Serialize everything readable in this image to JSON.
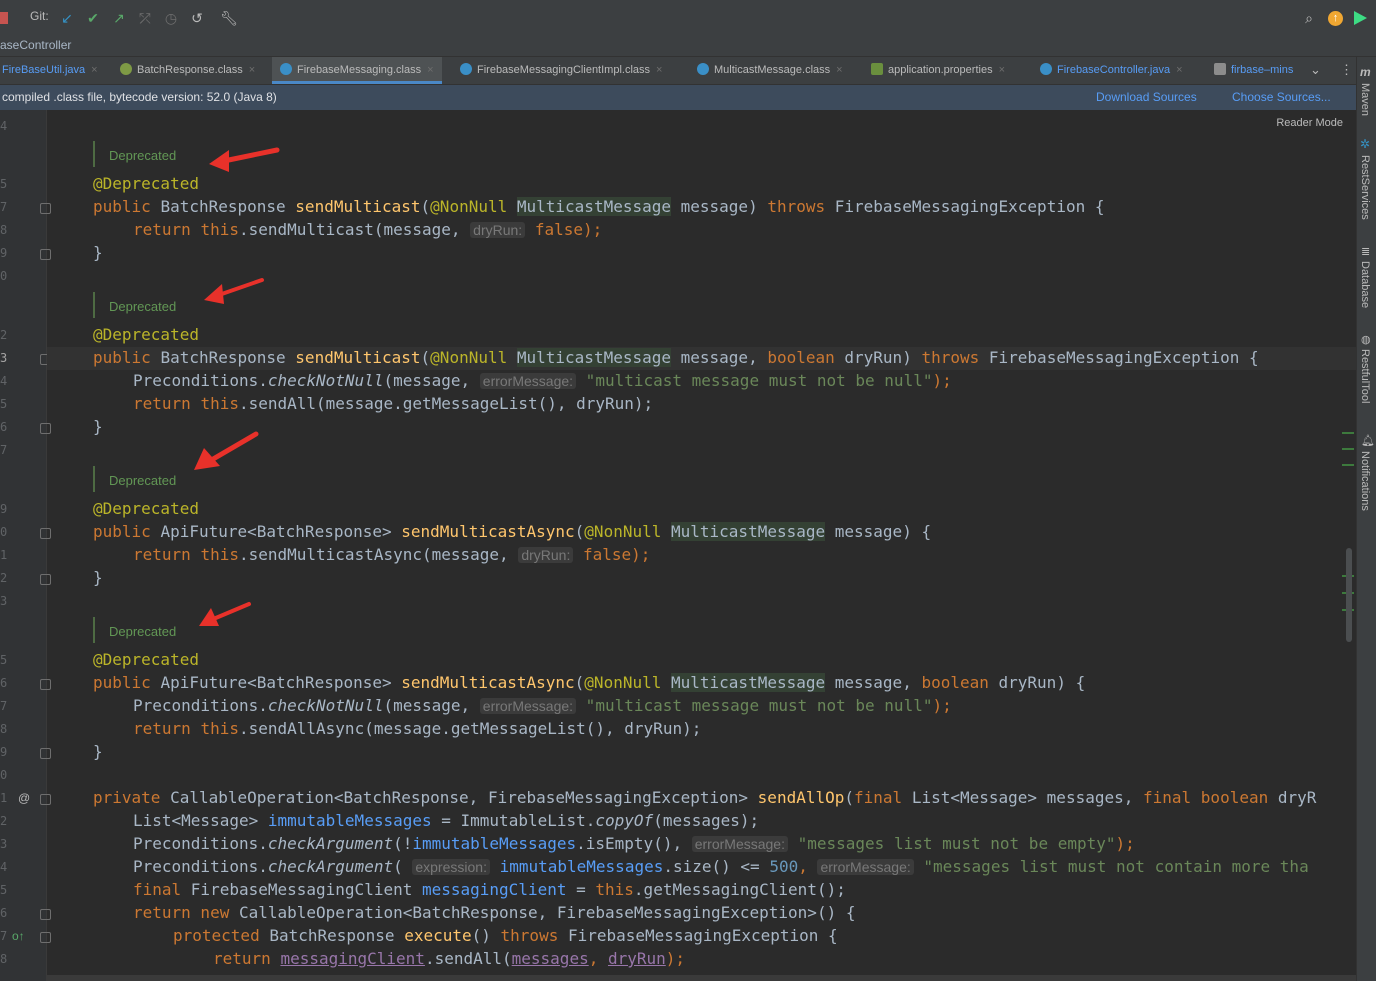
{
  "toolbar": {
    "git_label": "Git:",
    "icons": [
      "stop-icon",
      "git-update-icon",
      "git-commit-icon",
      "git-push-icon",
      "git-merge-icon",
      "history-icon",
      "rollback-icon",
      "wrench-icon",
      "search-icon",
      "update-icon",
      "jetbrains-icon"
    ]
  },
  "breadcrumb": {
    "text": "aseController"
  },
  "tabs": [
    {
      "label": "FireBaseUtil.java",
      "color": "#589df6"
    },
    {
      "label": "BatchResponse.class",
      "color": "#bbbbbb"
    },
    {
      "label": "FirebaseMessaging.class",
      "color": "#bbbbbb",
      "active": true
    },
    {
      "label": "FirebaseMessagingClientImpl.class",
      "color": "#bbbbbb"
    },
    {
      "label": "MulticastMessage.class",
      "color": "#bbbbbb"
    },
    {
      "label": "application.properties",
      "color": "#bbbbbb"
    },
    {
      "label": "FirebaseController.java",
      "color": "#589df6"
    },
    {
      "label": "firbase–mins",
      "color": "#589df6"
    }
  ],
  "banner": {
    "text": "compiled .class file, bytecode version: 52.0 (Java 8)",
    "download": "Download Sources",
    "choose": "Choose Sources..."
  },
  "reader_mode": "Reader Mode",
  "line_numbers": [
    "4",
    "5",
    "7",
    "8",
    "9",
    "0",
    "2",
    "3",
    "4",
    "5",
    "6",
    "7",
    "9",
    "0",
    "1",
    "2",
    "3",
    "5",
    "6",
    "7",
    "8",
    "9",
    "0",
    "1",
    "2",
    "3",
    "4",
    "5",
    "6",
    "7",
    "8"
  ],
  "docs": {
    "deprecated": "Deprecated"
  },
  "code": {
    "ann_deprecated": "@Deprecated",
    "l1": [
      "public ",
      "BatchResponse ",
      "sendMulticast",
      "(",
      "@NonNull ",
      "MulticastMessage",
      " message) ",
      "throws ",
      "FirebaseMessagingException {"
    ],
    "l2": [
      "return ",
      "this",
      ".sendMulticast(message, ",
      "dryRun:",
      " false",
      ");"
    ],
    "close": "}",
    "l4": [
      "public ",
      "BatchResponse ",
      "sendMulticast",
      "(",
      "@NonNull ",
      "MulticastMessage",
      " message, ",
      "boolean ",
      "dryRun) ",
      "throws ",
      "FirebaseMessagingException {"
    ],
    "l5": [
      "Preconditions.",
      "checkNotNull",
      "(message, ",
      "errorMessage:",
      " \"multicast message must not be null\"",
      ");"
    ],
    "l6": [
      "return ",
      "this",
      ".sendAll(message.getMessageList(), dryRun);"
    ],
    "l8": [
      "public ",
      "ApiFuture<BatchResponse> ",
      "sendMulticastAsync",
      "(",
      "@NonNull ",
      "MulticastMessage",
      " message) {"
    ],
    "l9": [
      "return ",
      "this",
      ".sendMulticastAsync(message, ",
      "dryRun:",
      " false",
      ");"
    ],
    "l11": [
      "public ",
      "ApiFuture<BatchResponse> ",
      "sendMulticastAsync",
      "(",
      "@NonNull ",
      "MulticastMessage",
      " message, ",
      "boolean ",
      "dryRun) {"
    ],
    "l12": [
      "Preconditions.",
      "checkNotNull",
      "(message, ",
      "errorMessage:",
      " \"multicast message must not be null\"",
      ");"
    ],
    "l13": [
      "return ",
      "this",
      ".sendAllAsync(message.getMessageList(), dryRun);"
    ],
    "p1": [
      "private ",
      "CallableOperation<BatchResponse, FirebaseMessagingException> ",
      "sendAllOp",
      "(",
      "final ",
      "List<Message> messages, ",
      "final boolean ",
      "dryR"
    ],
    "p2": [
      "List<Message> ",
      "immutableMessages",
      " = ImmutableList.",
      "copyOf",
      "(messages);"
    ],
    "p3": [
      "Preconditions.",
      "checkArgument",
      "(!",
      "immutableMessages",
      ".isEmpty(), ",
      "errorMessage:",
      " \"messages list must not be empty\"",
      ");"
    ],
    "p4": [
      "Preconditions.",
      "checkArgument",
      "( ",
      "expression:",
      " immutableMessages",
      ".size() <= ",
      "500",
      ", ",
      "errorMessage:",
      " \"messages list must not contain more tha"
    ],
    "p5": [
      "final ",
      "FirebaseMessagingClient ",
      "messagingClient",
      " = ",
      "this",
      ".getMessagingClient();"
    ],
    "p6": [
      "return new ",
      "CallableOperation<BatchResponse, FirebaseMessagingException>() {"
    ],
    "p7": [
      "protected ",
      "BatchResponse ",
      "execute",
      "() ",
      "throws ",
      "FirebaseMessagingException {"
    ],
    "p8": [
      "return ",
      "messagingClient",
      ".sendAll(",
      "messages",
      ", ",
      "dryRun",
      ");"
    ]
  },
  "right_tools": [
    "Maven",
    "RestServices",
    "Database",
    "RestfulTool",
    "Notifications"
  ]
}
